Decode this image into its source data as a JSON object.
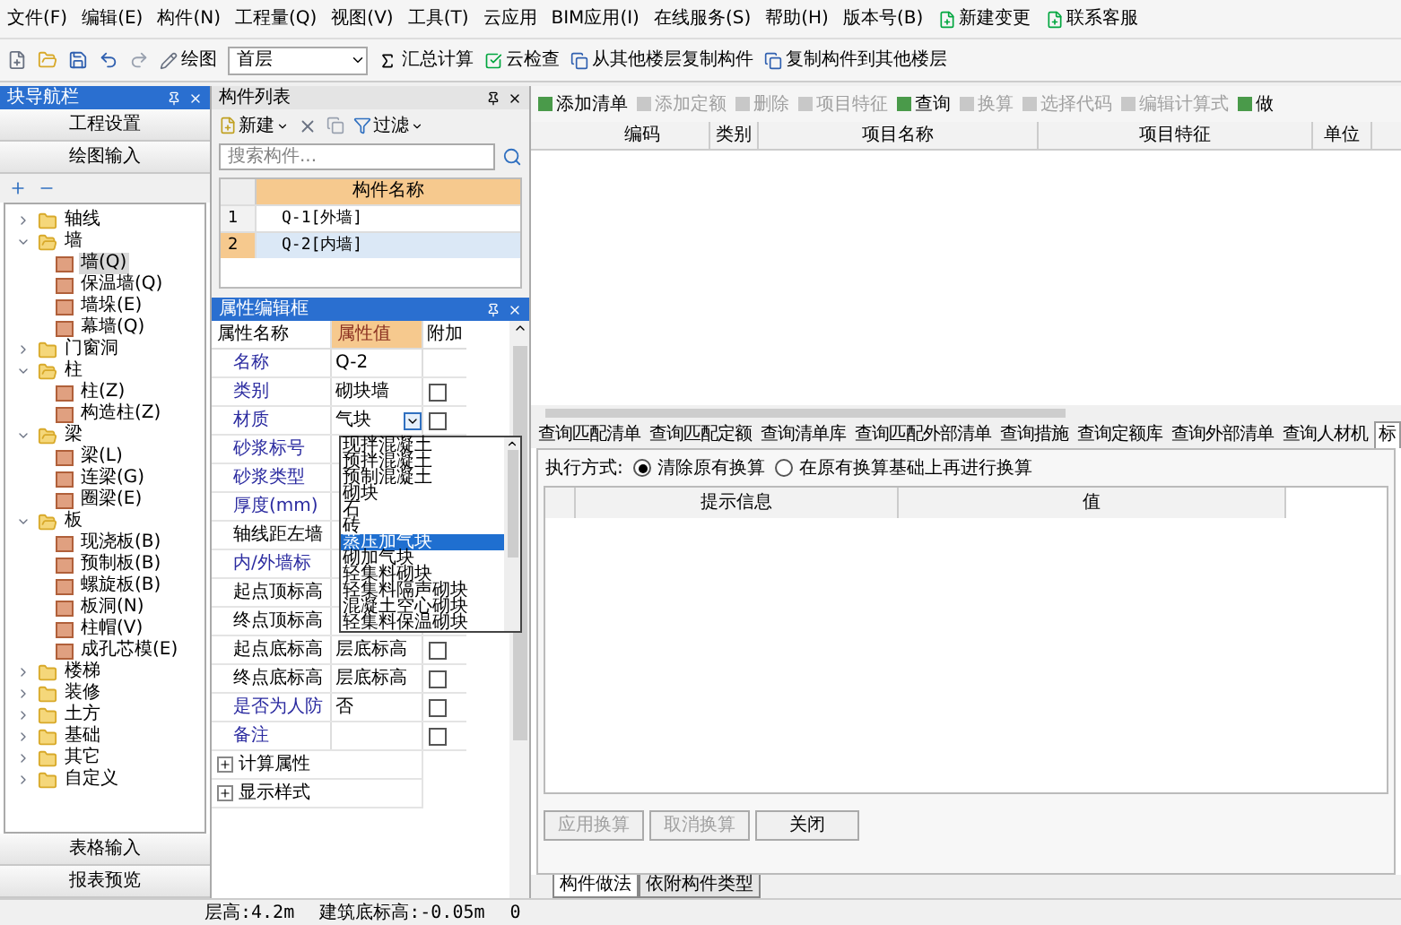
{
  "menu": {
    "items": [
      "文件(F)",
      "编辑(E)",
      "构件(N)",
      "工程量(Q)",
      "视图(V)",
      "工具(T)",
      "云应用",
      "BIM应用(I)",
      "在线服务(S)",
      "帮助(H)",
      "版本号(B)"
    ],
    "actions": [
      "新建变更",
      "联系客服"
    ]
  },
  "toolbar": {
    "draw": "绘图",
    "floor": "首层",
    "sum": "汇总计算",
    "cloud_check": "云检查",
    "copy_from": "从其他楼层复制构件",
    "copy_to": "复制构件到其他楼层"
  },
  "nav": {
    "title": "块导航栏",
    "top_buttons": [
      "工程设置",
      "绘图输入"
    ],
    "tree": [
      {
        "label": "轴线",
        "expanded": false
      },
      {
        "label": "墙",
        "expanded": true,
        "children": [
          {
            "label": "墙(Q)",
            "selected": true
          },
          {
            "label": "保温墙(Q)",
            "selected": false
          },
          {
            "label": "墙垛(E)",
            "selected": false
          },
          {
            "label": "幕墙(Q)",
            "selected": false
          }
        ]
      },
      {
        "label": "门窗洞",
        "expanded": false
      },
      {
        "label": "柱",
        "expanded": true,
        "children": [
          {
            "label": "柱(Z)",
            "selected": false
          },
          {
            "label": "构造柱(Z)",
            "selected": false
          }
        ]
      },
      {
        "label": "梁",
        "expanded": true,
        "children": [
          {
            "label": "梁(L)",
            "selected": false
          },
          {
            "label": "连梁(G)",
            "selected": false
          },
          {
            "label": "圈梁(E)",
            "selected": false
          }
        ]
      },
      {
        "label": "板",
        "expanded": true,
        "children": [
          {
            "label": "现浇板(B)",
            "selected": false
          },
          {
            "label": "预制板(B)",
            "selected": false
          },
          {
            "label": "螺旋板(B)",
            "selected": false
          },
          {
            "label": "板洞(N)",
            "selected": false
          },
          {
            "label": "柱帽(V)",
            "selected": false
          },
          {
            "label": "成孔芯模(E)",
            "selected": false
          }
        ]
      },
      {
        "label": "楼梯",
        "expanded": false
      },
      {
        "label": "装修",
        "expanded": false
      },
      {
        "label": "土方",
        "expanded": false
      },
      {
        "label": "基础",
        "expanded": false
      },
      {
        "label": "其它",
        "expanded": false
      },
      {
        "label": "自定义",
        "expanded": false
      }
    ],
    "bottom_buttons": [
      "表格输入",
      "报表预览"
    ]
  },
  "component_list": {
    "title": "构件列表",
    "new": "新建",
    "filter": "过滤",
    "search": {
      "placeholder": "搜索构件..."
    },
    "column": "构件名称",
    "rows": [
      {
        "index": "1",
        "name": "Q-1[外墙]",
        "selected": false
      },
      {
        "index": "2",
        "name": "Q-2[内墙]",
        "selected": true
      }
    ]
  },
  "property_editor": {
    "title": "属性编辑框",
    "columns": [
      "属性名称",
      "属性值",
      "附加"
    ],
    "rows": [
      {
        "name": "名称",
        "public": true,
        "value": "Q-2"
      },
      {
        "name": "类别",
        "public": true,
        "value": "砌块墙",
        "checked": false
      },
      {
        "name": "材质",
        "public": true,
        "value": "气块",
        "checked": false
      },
      {
        "name": "砂浆标号",
        "public": true
      },
      {
        "name": "砂浆类型",
        "public": true
      },
      {
        "name": "厚度(mm)",
        "public": true
      },
      {
        "name": "轴线距左墙",
        "public": false
      },
      {
        "name": "内/外墙标",
        "public": true
      },
      {
        "name": "起点顶标高",
        "public": false
      },
      {
        "name": "终点顶标高",
        "public": false
      },
      {
        "name": "起点底标高",
        "public": false,
        "value": "层底标高",
        "checked": false
      },
      {
        "name": "终点底标高",
        "public": false,
        "value": "层底标高",
        "checked": false
      },
      {
        "name": "是否为人防",
        "public": true,
        "value": "否",
        "checked": false
      },
      {
        "name": "备注",
        "public": true,
        "checked": false
      }
    ],
    "groups": [
      {
        "label": "计算属性",
        "expanded": false
      },
      {
        "label": "显示样式",
        "expanded": false
      }
    ],
    "material_options": [
      {
        "label": "现拌混凝土",
        "selected": false
      },
      {
        "label": "预拌混凝土",
        "selected": false
      },
      {
        "label": "预制混凝土",
        "selected": false
      },
      {
        "label": "砌块",
        "selected": false
      },
      {
        "label": "石",
        "selected": false
      },
      {
        "label": "砖",
        "selected": false
      },
      {
        "label": "蒸压加气块",
        "selected": true
      },
      {
        "label": "砌加气块",
        "selected": false
      },
      {
        "label": "轻集料砌块",
        "selected": false
      },
      {
        "label": "轻集料隔声砌块",
        "selected": false
      },
      {
        "label": "混凝土空心砌块",
        "selected": false
      },
      {
        "label": "轻集料保温砌块",
        "selected": false
      }
    ]
  },
  "method": {
    "toolbar": [
      {
        "label": "添加清单",
        "disabled": false
      },
      {
        "label": "添加定额",
        "disabled": true
      },
      {
        "label": "删除",
        "disabled": true
      },
      {
        "label": "项目特征",
        "disabled": true
      },
      {
        "label": "查询",
        "disabled": false
      },
      {
        "label": "换算",
        "disabled": true
      },
      {
        "label": "选择代码",
        "disabled": true
      },
      {
        "label": "编辑计算式",
        "disabled": true
      },
      {
        "label": "做",
        "disabled": false
      }
    ],
    "columns": [
      "编码",
      "类别",
      "项目名称",
      "项目特征",
      "单位"
    ],
    "query_tabs": [
      {
        "label": "查询匹配清单",
        "selected": false
      },
      {
        "label": "查询匹配定额",
        "selected": false
      },
      {
        "label": "查询清单库",
        "selected": false
      },
      {
        "label": "查询匹配外部清单",
        "selected": false
      },
      {
        "label": "查询措施",
        "selected": false
      },
      {
        "label": "查询定额库",
        "selected": false
      },
      {
        "label": "查询外部清单",
        "selected": false
      },
      {
        "label": "查询人材机",
        "selected": false
      },
      {
        "label": "标",
        "selected": true
      }
    ],
    "exec_label": "执行方式:",
    "exec_options": [
      {
        "label": "清除原有换算",
        "selected": true
      },
      {
        "label": "在原有换算基础上再进行换算",
        "selected": false
      }
    ],
    "info_columns": [
      "提示信息",
      "值"
    ],
    "buttons": [
      {
        "label": "应用换算",
        "disabled": true
      },
      {
        "label": "取消换算",
        "disabled": true
      },
      {
        "label": "关闭",
        "disabled": false
      }
    ],
    "bottom_tabs": [
      {
        "label": "构件做法",
        "selected": true
      },
      {
        "label": "依附构件类型",
        "selected": false
      }
    ]
  },
  "status_bar": [
    "层高:4.2m",
    "建筑底标高:-0.05m",
    "0"
  ]
}
